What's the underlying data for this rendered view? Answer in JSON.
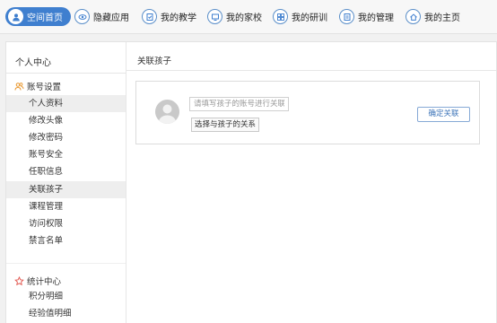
{
  "topnav": {
    "items": [
      {
        "label": "空间首页",
        "icon": "user-icon",
        "active": true
      },
      {
        "label": "隐藏应用",
        "icon": "eye-icon",
        "active": false
      },
      {
        "label": "我的教学",
        "icon": "teaching-icon",
        "active": false
      },
      {
        "label": "我的家校",
        "icon": "monitor-icon",
        "active": false
      },
      {
        "label": "我的研训",
        "icon": "grid-icon",
        "active": false
      },
      {
        "label": "我的管理",
        "icon": "document-icon",
        "active": false
      },
      {
        "label": "我的主页",
        "icon": "home-icon",
        "active": false
      }
    ],
    "accent_color": "#3f7fcf"
  },
  "sidebar": {
    "title": "个人中心",
    "account_group": {
      "label": "账号设置",
      "icon": "users-icon",
      "items": [
        {
          "label": "个人资料"
        },
        {
          "label": "修改头像"
        },
        {
          "label": "修改密码"
        },
        {
          "label": "账号安全"
        },
        {
          "label": "任职信息"
        },
        {
          "label": "关联孩子"
        },
        {
          "label": "课程管理"
        },
        {
          "label": "访问权限"
        },
        {
          "label": "禁言名单"
        }
      ]
    },
    "stats_group": {
      "label": "统计中心",
      "icon": "star-icon",
      "items": [
        {
          "label": "积分明细"
        },
        {
          "label": "经验值明细"
        }
      ]
    }
  },
  "content": {
    "title": "关联孩子",
    "form": {
      "account_placeholder": "请填写孩子的账号进行关联",
      "relation_label": "选择与孩子的关系",
      "confirm_label": "确定关联"
    }
  }
}
